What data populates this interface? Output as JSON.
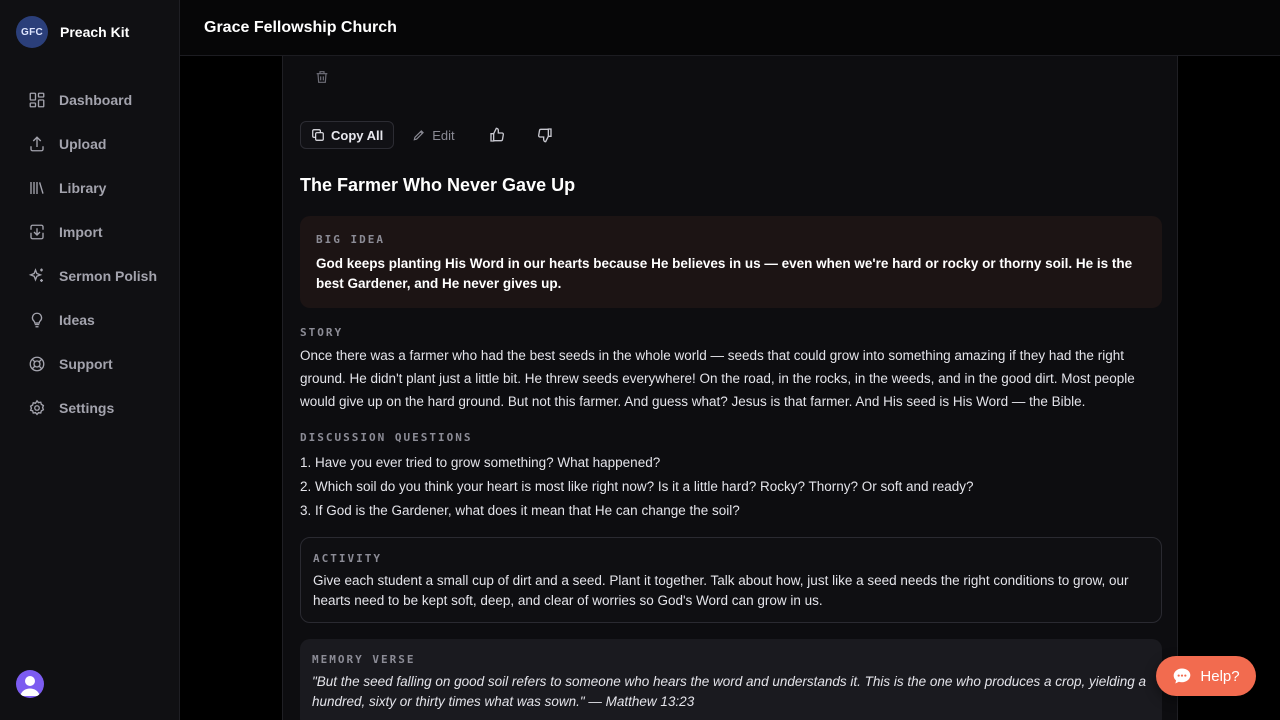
{
  "brand": {
    "logo_text": "GFC",
    "name": "Preach Kit"
  },
  "sidebar": {
    "items": [
      {
        "label": "Dashboard",
        "icon": "dashboard-icon"
      },
      {
        "label": "Upload",
        "icon": "upload-icon"
      },
      {
        "label": "Library",
        "icon": "library-icon"
      },
      {
        "label": "Import",
        "icon": "import-icon"
      },
      {
        "label": "Sermon Polish",
        "icon": "sparkles-icon"
      },
      {
        "label": "Ideas",
        "icon": "lightbulb-icon"
      },
      {
        "label": "Support",
        "icon": "lifebuoy-icon"
      },
      {
        "label": "Settings",
        "icon": "gear-icon"
      }
    ]
  },
  "header": {
    "title": "Grace Fellowship Church"
  },
  "toolbar": {
    "copy_label": "Copy All",
    "edit_label": "Edit"
  },
  "lesson": {
    "title": "The Farmer Who Never Gave Up",
    "big_idea": {
      "label": "BIG IDEA",
      "text": "God keeps planting His Word in our hearts because He believes in us — even when we're hard or rocky or thorny soil. He is the best Gardener, and He never gives up."
    },
    "story": {
      "label": "STORY",
      "text": "Once there was a farmer who had the best seeds in the whole world — seeds that could grow into something amazing if they had the right ground. He didn't plant just a little bit. He threw seeds everywhere! On the road, in the rocks, in the weeds, and in the good dirt. Most people would give up on the hard ground. But not this farmer. And guess what? Jesus is that farmer. And His seed is His Word — the Bible."
    },
    "discussion": {
      "label": "DISCUSSION QUESTIONS",
      "questions": [
        "1. Have you ever tried to grow something? What happened?",
        "2. Which soil do you think your heart is most like right now? Is it a little hard? Rocky? Thorny? Or soft and ready?",
        "3. If God is the Gardener, what does it mean that He can change the soil?"
      ]
    },
    "activity": {
      "label": "ACTIVITY",
      "text": "Give each student a small cup of dirt and a seed. Plant it together. Talk about how, just like a seed needs the right conditions to grow, our hearts need to be kept soft, deep, and clear of worries so God's Word can grow in us."
    },
    "memory_verse": {
      "label": "MEMORY VERSE",
      "text": "\"But the seed falling on good soil refers to someone who hears the word and understands it. This is the one who produces a crop, yielding a hundred, sixty or thirty times what was sown.\" — Matthew 13:23"
    }
  },
  "help": {
    "label": "Help?"
  },
  "colors": {
    "accent": "#f26b4f",
    "big_idea_bg": "#1c1414",
    "avatar": "#7c5cf0"
  }
}
